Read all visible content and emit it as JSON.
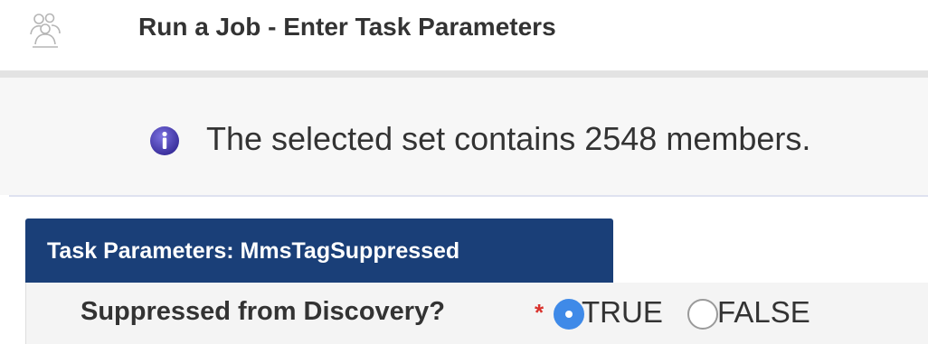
{
  "header": {
    "title": "Run a Job - Enter Task Parameters",
    "icon": "users-group-icon"
  },
  "info": {
    "icon": "info-icon",
    "message": "The selected set contains 2548 members."
  },
  "task_panel": {
    "tab_label": "Task Parameters: MmsTagSuppressed",
    "parameter": {
      "label": "Suppressed from Discovery?",
      "required_marker": "*",
      "options": [
        {
          "label": "TRUE",
          "selected": true
        },
        {
          "label": "FALSE",
          "selected": false
        }
      ]
    }
  },
  "colors": {
    "tab_background": "#1a3f78",
    "radio_selected": "#3f8ae8",
    "required_star": "#d9322c",
    "info_icon": "#4a3fb0"
  }
}
